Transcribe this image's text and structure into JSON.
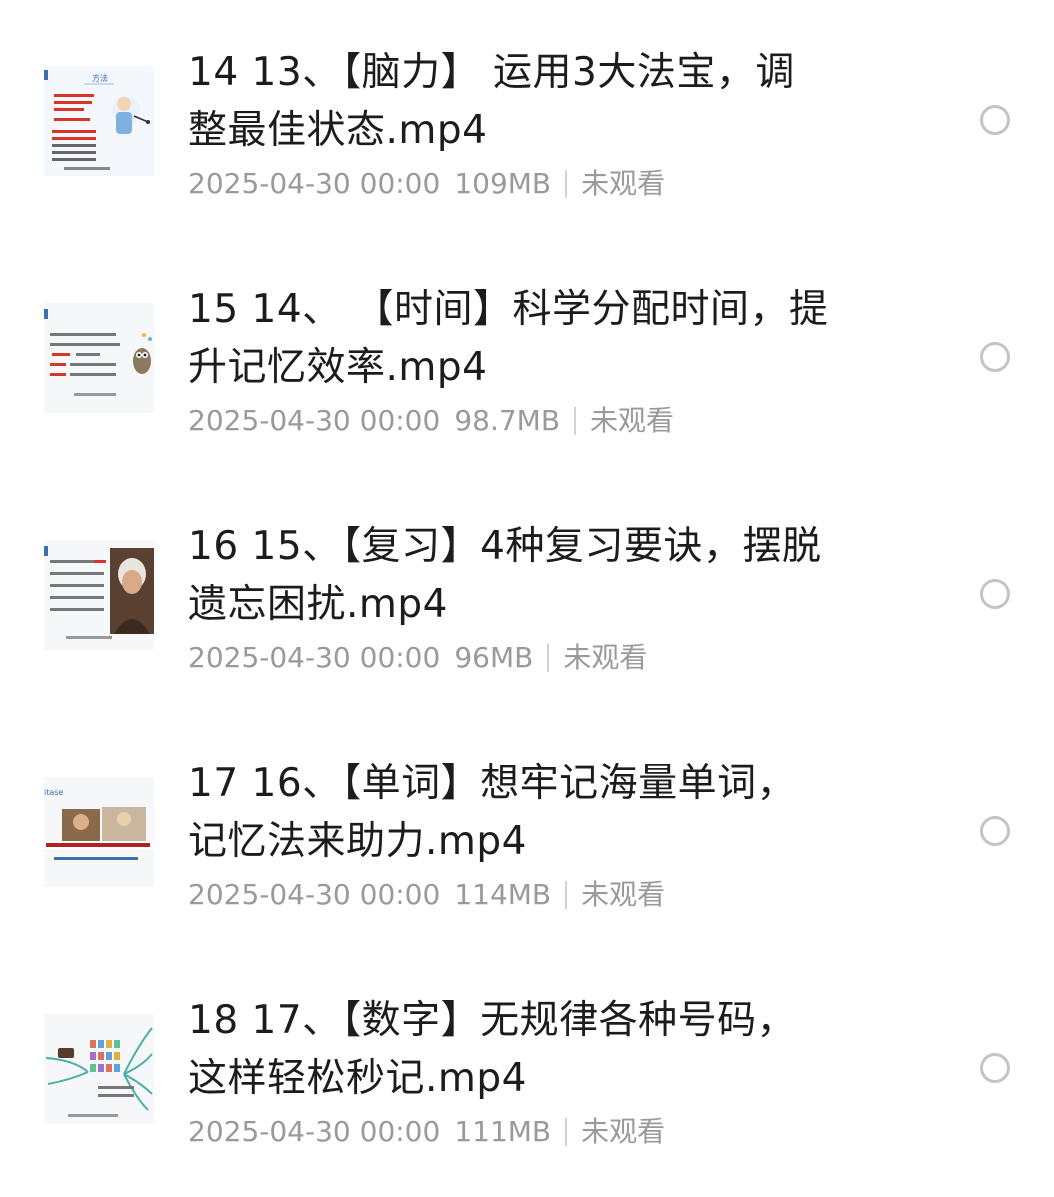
{
  "files": [
    {
      "index": "14",
      "name_line1": "14 13、【脑力】 运用3大法宝，调",
      "name_line2": "整最佳状态.mp4",
      "date": "2025-04-30 00:00",
      "size": "109MB",
      "status": "未观看",
      "thumb_icon": "slide-thumbnail-teacher",
      "thumb_heading": "方法"
    },
    {
      "index": "15",
      "name_line1": "15 14、 【时间】科学分配时间，提",
      "name_line2": "升记忆效率.mp4",
      "date": "2025-04-30 00:00",
      "size": "98.7MB",
      "status": "未观看",
      "thumb_icon": "slide-thumbnail-owl"
    },
    {
      "index": "16",
      "name_line1": "16 15、【复习】4种复习要诀，摆脱",
      "name_line2": "遗忘困扰.mp4",
      "date": "2025-04-30 00:00",
      "size": "96MB",
      "status": "未观看",
      "thumb_icon": "slide-thumbnail-portrait"
    },
    {
      "index": "17",
      "name_line1": "17 16、【单词】想牢记海量单词，",
      "name_line2": "记忆法来助力.mp4",
      "date": "2025-04-30 00:00",
      "size": "114MB",
      "status": "未观看",
      "thumb_icon": "slide-thumbnail-photos",
      "thumb_heading": "itase"
    },
    {
      "index": "18",
      "name_line1": "18 17、【数字】无规律各种号码，",
      "name_line2": "这样轻松秒记.mp4",
      "date": "2025-04-30 00:00",
      "size": "111MB",
      "status": "未观看",
      "thumb_icon": "slide-thumbnail-mindmap"
    }
  ],
  "colors": {
    "title": "#1c1c1c",
    "meta": "#9a9a9a",
    "radio_border": "#c4c4c4",
    "thumb_red": "#d9342b",
    "thumb_blue": "#3a6fb0"
  }
}
